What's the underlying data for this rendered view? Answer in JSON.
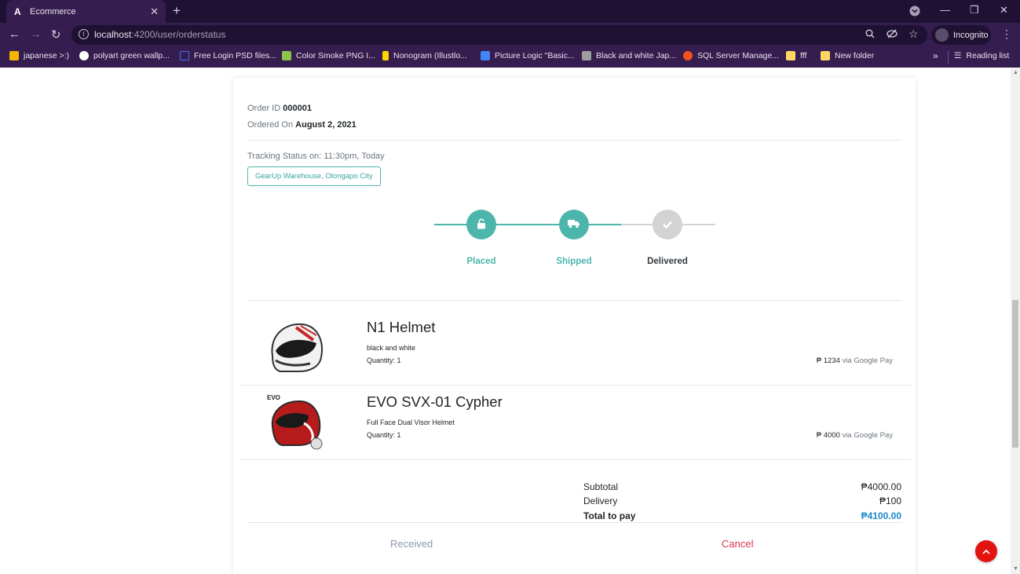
{
  "browser": {
    "tab_title": "Ecommerce",
    "url_host": "localhost",
    "url_path": ":4200/user/orderstatus",
    "profile_label": "Incognito",
    "bookmarks": [
      {
        "label": "japanese >:)",
        "color": "#f4b400"
      },
      {
        "label": "polyart green wallp...",
        "color": "#ffffff"
      },
      {
        "label": "Free Login PSD files...",
        "color": "#4a6cf7"
      },
      {
        "label": "Color Smoke PNG I...",
        "color": "#8bc34a"
      },
      {
        "label": "Nonogram (Illustlo...",
        "color": "#ffd600"
      },
      {
        "label": "Picture Logic \"Basic...",
        "color": "#4285f4"
      },
      {
        "label": "Black and white Jap...",
        "color": "#9e9e9e"
      },
      {
        "label": "SQL Server Manage...",
        "color": "#f4511e"
      },
      {
        "label": "fff",
        "color": "#fdd663"
      },
      {
        "label": "New folder",
        "color": "#fdd663"
      }
    ],
    "more_label": "»",
    "reading_list_label": "Reading list"
  },
  "order": {
    "id_label": "Order ID",
    "id": "000001",
    "ordered_on_label": "Ordered On",
    "ordered_on": "August 2, 2021",
    "tracking_status": "Tracking Status on: 11:30pm, Today",
    "location": "GearUp Warehouse, Olongapo City"
  },
  "steps": [
    {
      "label": "Placed",
      "icon": "unlock-icon",
      "complete": true
    },
    {
      "label": "Shipped",
      "icon": "truck-icon",
      "complete": true
    },
    {
      "label": "Delivered",
      "icon": "check-icon",
      "complete": false
    }
  ],
  "colors": {
    "accent": "#4cb6ad",
    "pending": "#d3d3d3",
    "total": "#1e88c9",
    "cancel": "#dc3545",
    "fab": "#e3130f"
  },
  "products": [
    {
      "name": "N1 Helmet",
      "description": "black and white",
      "quantity": "Quantity: 1",
      "price": "₱ 1234",
      "payment": "via Google Pay"
    },
    {
      "name": "EVO SVX-01 Cypher",
      "description": "Full Face Dual Visor Helmet",
      "quantity": "Quantity: 1",
      "price": "₱ 4000",
      "payment": "via Google Pay"
    }
  ],
  "summary": {
    "subtotal_label": "Subtotal",
    "subtotal": "₱4000.00",
    "delivery_label": "Delivery",
    "delivery": "₱100",
    "total_label": "Total to pay",
    "total": "₱4100.00"
  },
  "actions": {
    "received": "Received",
    "cancel": "Cancel"
  }
}
